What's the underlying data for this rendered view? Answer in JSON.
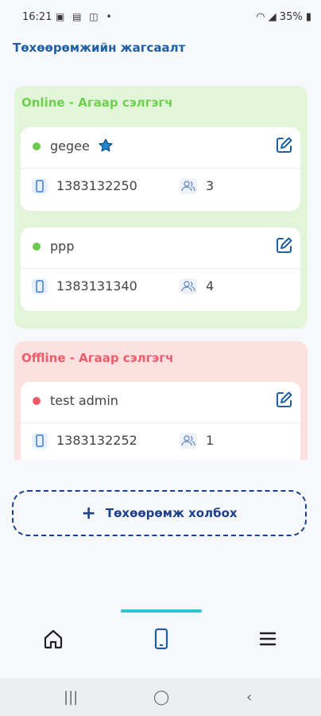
{
  "status_bar": {
    "time": "16:21",
    "battery": "35%"
  },
  "header": {
    "title": "Төхөөрөмжийн жагсаалт"
  },
  "groups": [
    {
      "title": "Online - Агаар сэлгэгч",
      "status": "online",
      "devices": [
        {
          "name": "gegee",
          "phone": "1383132250",
          "users": "3",
          "favorite": true
        },
        {
          "name": "ppp",
          "phone": "1383131340",
          "users": "4",
          "favorite": false
        }
      ]
    },
    {
      "title": "Offline - Агаар сэлгэгч",
      "status": "offline",
      "devices": [
        {
          "name": "test admin",
          "phone": "1383132252",
          "users": "1",
          "favorite": false
        }
      ]
    }
  ],
  "connect_button": {
    "label": "Төхөөрөмж холбох"
  },
  "colors": {
    "online_bg": "#e3f5d9",
    "online_text": "#6cd14d",
    "offline_bg": "#fde0e0",
    "offline_text": "#ef5b6a",
    "accent": "#1e3f8a",
    "tab_indicator": "#2ec4d0"
  },
  "bottom_nav": {
    "items": [
      {
        "icon": "home-icon",
        "active": false
      },
      {
        "icon": "device-icon",
        "active": true
      },
      {
        "icon": "menu-icon",
        "active": false
      }
    ]
  }
}
